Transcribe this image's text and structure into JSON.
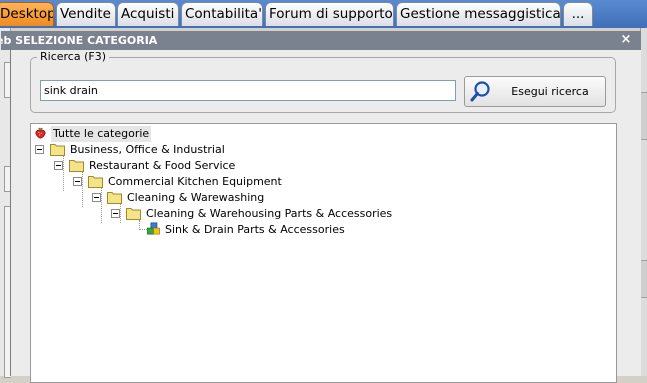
{
  "tabs": [
    {
      "label": "Desktop",
      "active": true
    },
    {
      "label": "Vendite"
    },
    {
      "label": "Acquisti"
    },
    {
      "label": "Contabilita'"
    },
    {
      "label": "Forum di supporto"
    },
    {
      "label": "Gestione messaggistica"
    },
    {
      "label": "..."
    }
  ],
  "dialog": {
    "title": "eb SELEZIONE CATEGORIA",
    "close_glyph": "×",
    "search_group_label": "Ricerca (F3)",
    "search_value": "sink drain",
    "search_button_label": "Esegui ricerca",
    "search_button_icon": "magnifier-icon"
  },
  "tree": {
    "root": {
      "label": "Tutte le categorie",
      "icon": "strawberry-icon"
    },
    "nodes": [
      {
        "label": "Business, Office & Industrial",
        "icon": "folder-icon"
      },
      {
        "label": "Restaurant & Food Service",
        "icon": "folder-icon"
      },
      {
        "label": "Commercial Kitchen Equipment",
        "icon": "folder-icon"
      },
      {
        "label": "Cleaning & Warewashing",
        "icon": "folder-icon"
      },
      {
        "label": "Cleaning & Warehousing Parts & Accessories",
        "icon": "folder-icon"
      },
      {
        "label": "Sink & Drain Parts & Accessories",
        "icon": "leaf-category-icon"
      }
    ]
  },
  "colors": {
    "active_tab": "#f39a2e",
    "tab_bar": "#4a7bc4",
    "title_bar": "#7a8290",
    "folder": "#f5e38a"
  }
}
